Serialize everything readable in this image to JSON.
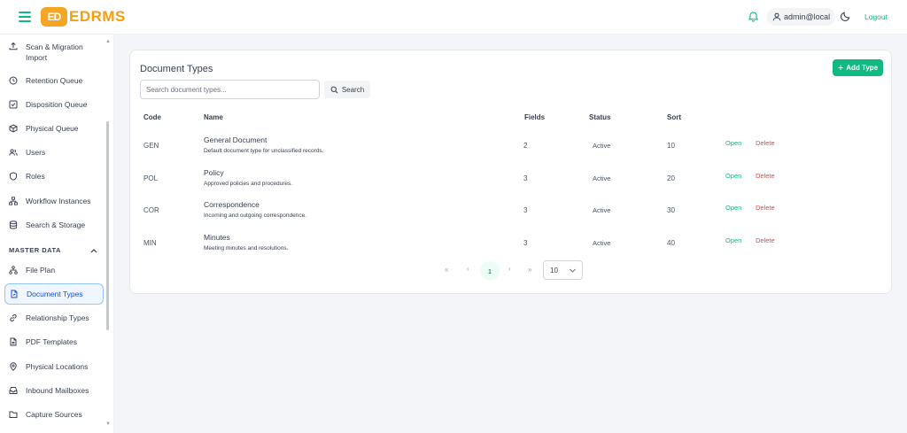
{
  "header": {
    "logo_mark": "ED",
    "logo_text": "EDRMS",
    "user": "admin@local",
    "logout": "Logout"
  },
  "sidebar": {
    "items_top": [
      {
        "label": "Scan & Migration Import",
        "icon": "upload-icon"
      },
      {
        "label": "Retention Queue",
        "icon": "clock-icon"
      },
      {
        "label": "Disposition Queue",
        "icon": "checkbox-icon"
      },
      {
        "label": "Physical Queue",
        "icon": "box-icon"
      },
      {
        "label": "Users",
        "icon": "users-icon"
      },
      {
        "label": "Roles",
        "icon": "shield-icon"
      },
      {
        "label": "Workflow Instances",
        "icon": "workflow-icon"
      },
      {
        "label": "Search & Storage",
        "icon": "database-icon"
      }
    ],
    "section_title": "MASTER DATA",
    "items_master": [
      {
        "label": "File Plan",
        "icon": "tree-icon"
      },
      {
        "label": "Document Types",
        "icon": "document-icon",
        "active": true
      },
      {
        "label": "Relationship Types",
        "icon": "link-icon"
      },
      {
        "label": "PDF Templates",
        "icon": "file-icon"
      },
      {
        "label": "Physical Locations",
        "icon": "map-pin-icon"
      },
      {
        "label": "Inbound Mailboxes",
        "icon": "inbox-icon"
      },
      {
        "label": "Capture Sources",
        "icon": "folder-icon"
      }
    ]
  },
  "main": {
    "title": "Document Types",
    "add_button": "Add Type",
    "search_placeholder": "Search document types...",
    "search_button": "Search",
    "columns": {
      "code": "Code",
      "name": "Name",
      "fields": "Fields",
      "status": "Status",
      "sort": "Sort"
    },
    "rows": [
      {
        "code": "GEN",
        "name": "General Document",
        "desc": "Default document type for unclassified records.",
        "fields": "2",
        "status": "Active",
        "sort": "10"
      },
      {
        "code": "POL",
        "name": "Policy",
        "desc": "Approved policies and procedures.",
        "fields": "3",
        "status": "Active",
        "sort": "20"
      },
      {
        "code": "COR",
        "name": "Correspondence",
        "desc": "Incoming and outgoing correspondence.",
        "fields": "3",
        "status": "Active",
        "sort": "30"
      },
      {
        "code": "MIN",
        "name": "Minutes",
        "desc": "Meeting minutes and resolutions.",
        "fields": "3",
        "status": "Active",
        "sort": "40"
      }
    ],
    "row_actions": {
      "open": "Open",
      "delete": "Delete"
    },
    "pagination": {
      "first": "«",
      "prev": "‹",
      "current": "1",
      "next": "›",
      "last": "»",
      "page_size": "10"
    }
  },
  "colors": {
    "accent": "#10b981",
    "danger": "#ef4444",
    "logo": "#f59e0b",
    "active_nav": "#1d4ed8"
  }
}
